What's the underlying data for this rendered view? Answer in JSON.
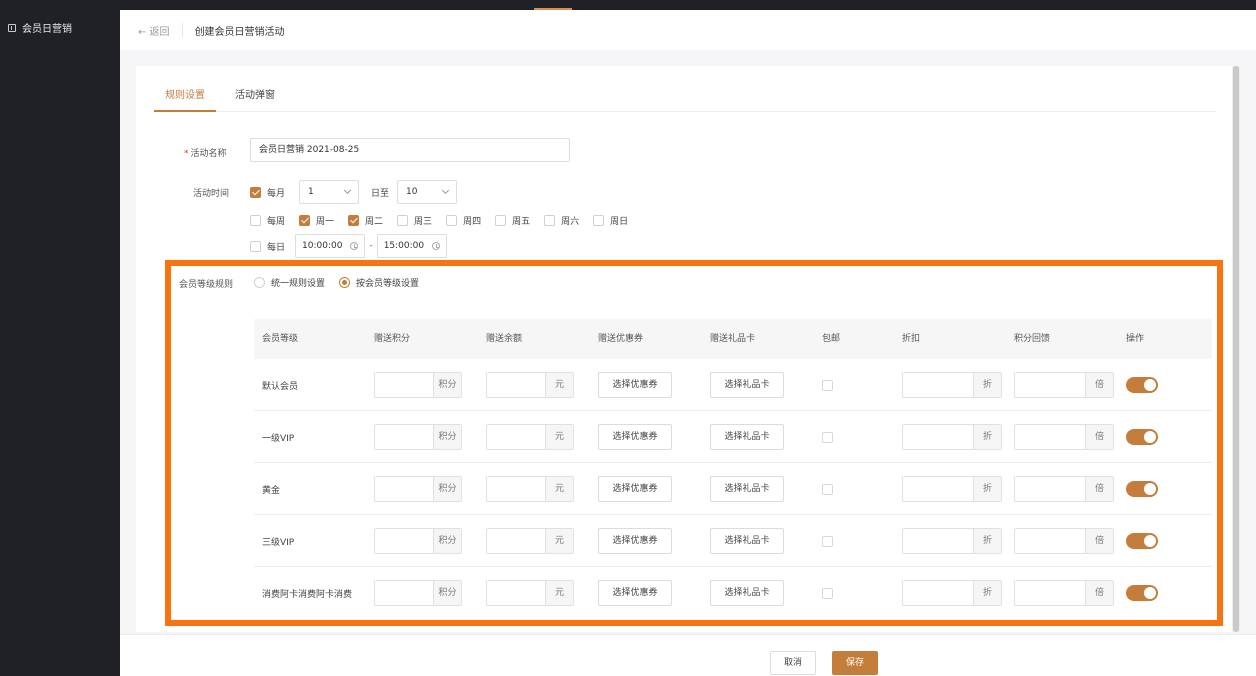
{
  "sidebar": {
    "item_label": "会员日营销"
  },
  "header": {
    "back_label": "← 返回",
    "title": "创建会员日营销活动"
  },
  "tabs": [
    {
      "label": "规则设置"
    },
    {
      "label": "活动弹窗"
    }
  ],
  "form": {
    "name_label": "活动名称",
    "name_required_mark": "*",
    "name_value": "会员日营销  2021-08-25",
    "time_label": "活动时间",
    "monthly": {
      "label": "每月",
      "checked": true,
      "start_value": "1",
      "to_label": "日至",
      "end_value": "10"
    },
    "weekly": {
      "label": "每周",
      "checked": false,
      "days": [
        {
          "label": "周一",
          "checked": true
        },
        {
          "label": "周二",
          "checked": true
        },
        {
          "label": "周三",
          "checked": false
        },
        {
          "label": "周四",
          "checked": false
        },
        {
          "label": "周五",
          "checked": false
        },
        {
          "label": "周六",
          "checked": false
        },
        {
          "label": "周日",
          "checked": false
        }
      ]
    },
    "daily": {
      "label": "每日",
      "checked": false,
      "start_time": "10:00:00",
      "dash": "-",
      "end_time": "15:00:00"
    },
    "level_rule_label": "会员等级规则",
    "level_rule_options": [
      {
        "label": "统一规则设置",
        "checked": false
      },
      {
        "label": "按会员等级设置",
        "checked": true
      }
    ]
  },
  "table": {
    "headers": [
      "会员等级",
      "赠送积分",
      "赠送余额",
      "赠送优惠券",
      "赠送礼品卡",
      "包邮",
      "折扣",
      "积分回馈",
      "操作"
    ],
    "units": {
      "points": "积分",
      "balance": "元",
      "discount": "折",
      "multiplier": "倍"
    },
    "coupon_button": "选择优惠券",
    "giftcard_button": "选择礼品卡",
    "rows": [
      {
        "level": "默认会员"
      },
      {
        "level": "一级VIP"
      },
      {
        "level": "黄金"
      },
      {
        "level": "三级VIP"
      },
      {
        "level": "消费阿卡消费阿卡消费"
      }
    ]
  },
  "footer": {
    "cancel_label": "取消",
    "save_label": "保存"
  },
  "colors": {
    "accent": "#c57d3c",
    "highlight": "#fa7311",
    "sidebar_bg": "#1f2126"
  }
}
